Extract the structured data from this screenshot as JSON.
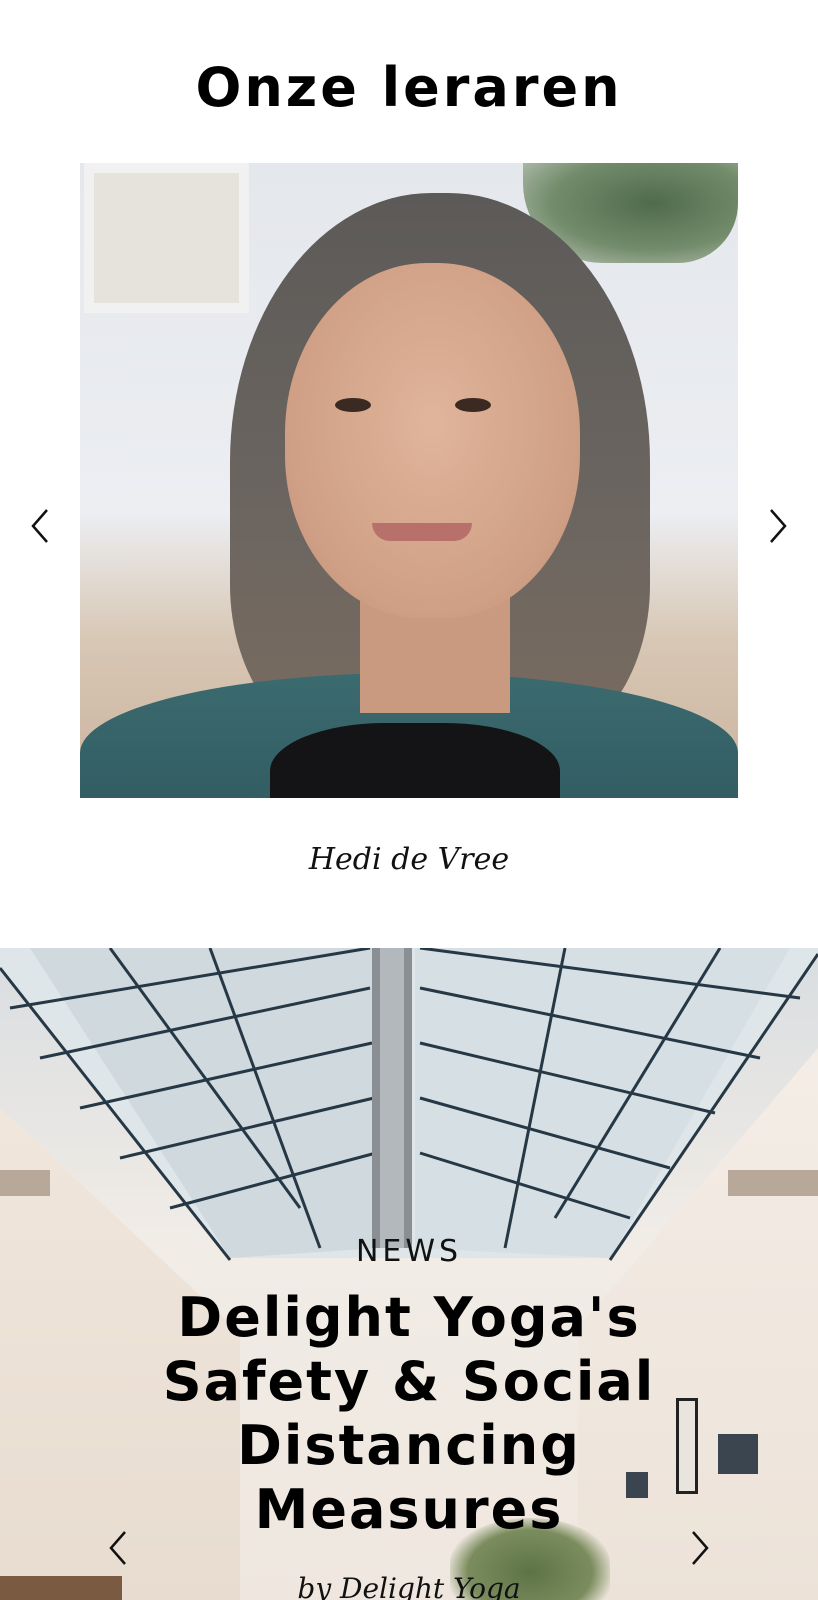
{
  "teachers": {
    "title": "Onze leraren",
    "current_teacher": {
      "name": "Hedi de Vree"
    }
  },
  "news": {
    "category": "NEWS",
    "headline": "Delight Yoga's Safety & Social Distancing Measures",
    "author": "by Delight Yoga"
  },
  "icons": {
    "prev": "chevron-left-icon",
    "next": "chevron-right-icon"
  },
  "colors": {
    "text": "#000000",
    "background": "#ffffff"
  }
}
